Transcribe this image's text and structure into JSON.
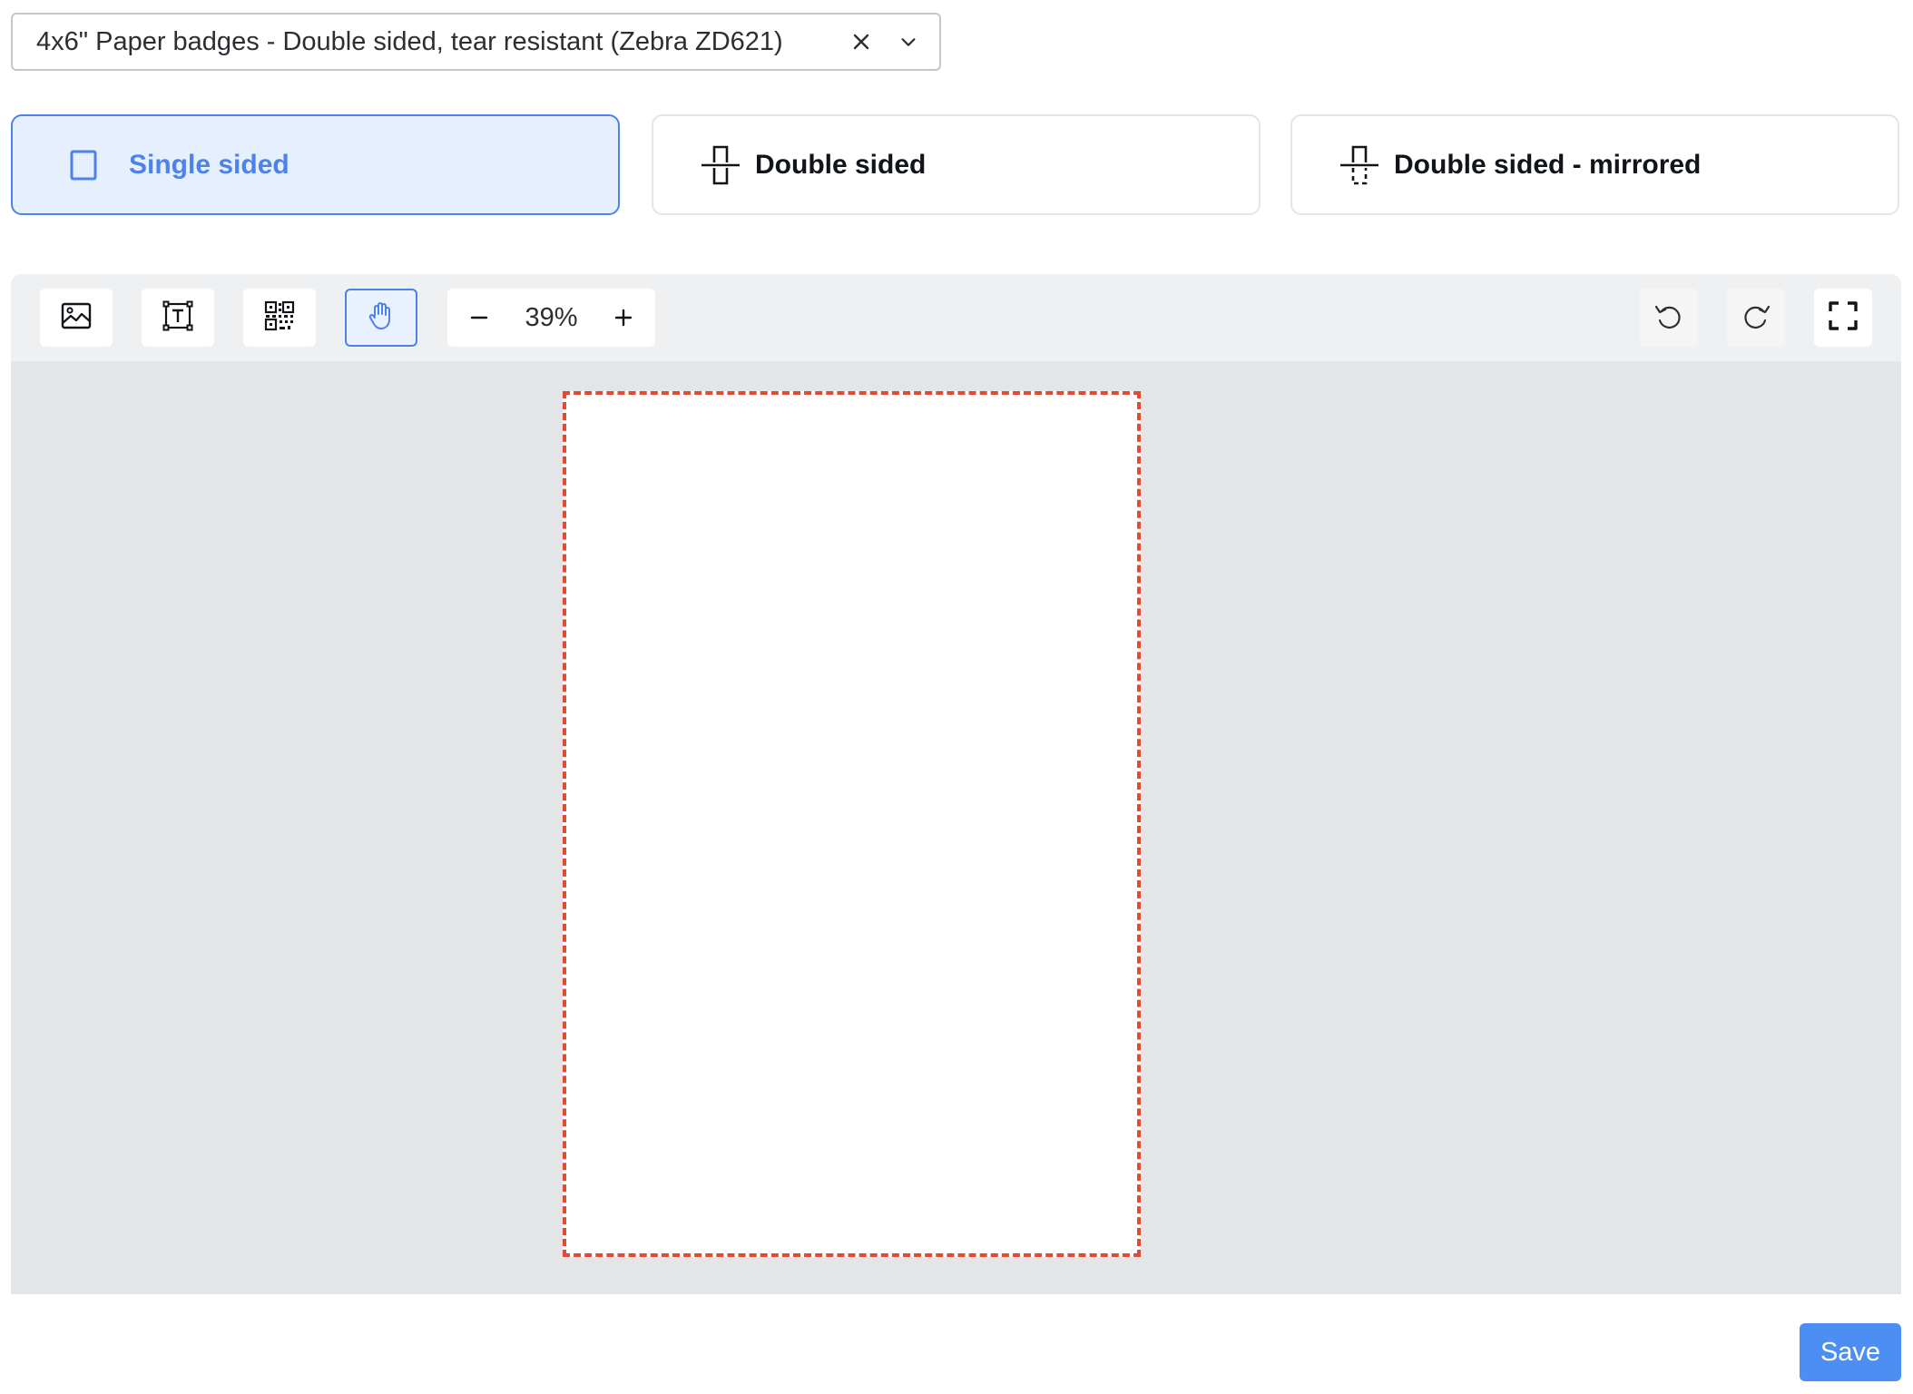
{
  "badge_select": {
    "value": "4x6\" Paper badges - Double sided, tear resistant (Zebra ZD621)",
    "clear_icon": "close-icon",
    "open_icon": "chevron-down-icon"
  },
  "print_modes": [
    {
      "label": "Single sided",
      "icon": "single-sided-icon",
      "selected": true
    },
    {
      "label": "Double sided",
      "icon": "double-sided-icon",
      "selected": false
    },
    {
      "label": "Double sided - mirrored",
      "icon": "double-sided-mirrored-icon",
      "selected": false
    }
  ],
  "toolbar": {
    "tools": [
      {
        "icon": "image-icon",
        "active": false
      },
      {
        "icon": "text-icon",
        "active": false
      },
      {
        "icon": "qr-code-icon",
        "active": false
      },
      {
        "icon": "hand-icon",
        "active": true
      }
    ],
    "zoom": {
      "minus_label": "−",
      "value": "39%",
      "plus_label": "+"
    },
    "undo_icon": "undo-icon",
    "redo_icon": "redo-icon",
    "fullscreen_icon": "fullscreen-icon"
  },
  "colors": {
    "accent": "#4d82e8",
    "active_bg": "#e6effd",
    "badge_border": "#e24a33",
    "save_bg": "#4d8ef2",
    "canvas_bg": "#e4e5e7"
  },
  "actions": {
    "save_label": "Save"
  }
}
